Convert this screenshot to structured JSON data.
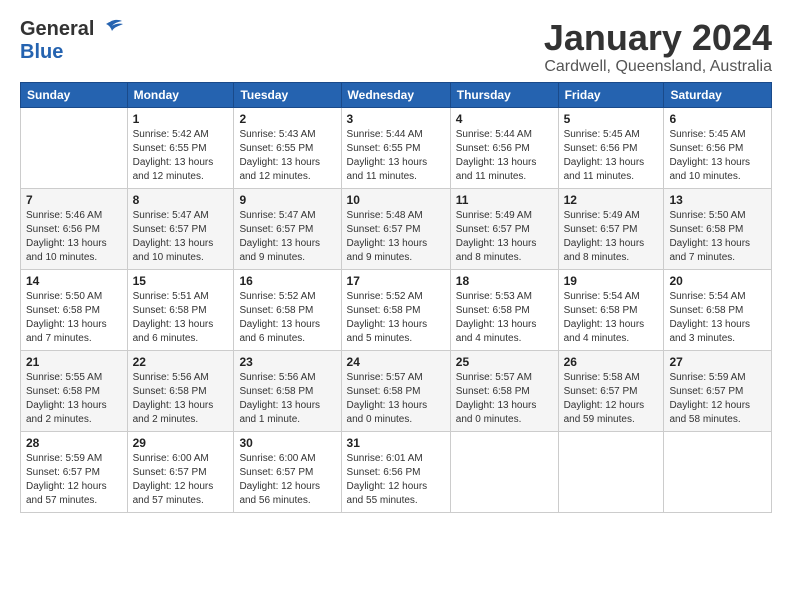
{
  "header": {
    "logo_general": "General",
    "logo_blue": "Blue",
    "month_title": "January 2024",
    "location": "Cardwell, Queensland, Australia"
  },
  "days_of_week": [
    "Sunday",
    "Monday",
    "Tuesday",
    "Wednesday",
    "Thursday",
    "Friday",
    "Saturday"
  ],
  "weeks": [
    [
      {
        "day": "",
        "info": ""
      },
      {
        "day": "1",
        "info": "Sunrise: 5:42 AM\nSunset: 6:55 PM\nDaylight: 13 hours\nand 12 minutes."
      },
      {
        "day": "2",
        "info": "Sunrise: 5:43 AM\nSunset: 6:55 PM\nDaylight: 13 hours\nand 12 minutes."
      },
      {
        "day": "3",
        "info": "Sunrise: 5:44 AM\nSunset: 6:55 PM\nDaylight: 13 hours\nand 11 minutes."
      },
      {
        "day": "4",
        "info": "Sunrise: 5:44 AM\nSunset: 6:56 PM\nDaylight: 13 hours\nand 11 minutes."
      },
      {
        "day": "5",
        "info": "Sunrise: 5:45 AM\nSunset: 6:56 PM\nDaylight: 13 hours\nand 11 minutes."
      },
      {
        "day": "6",
        "info": "Sunrise: 5:45 AM\nSunset: 6:56 PM\nDaylight: 13 hours\nand 10 minutes."
      }
    ],
    [
      {
        "day": "7",
        "info": "Sunrise: 5:46 AM\nSunset: 6:56 PM\nDaylight: 13 hours\nand 10 minutes."
      },
      {
        "day": "8",
        "info": "Sunrise: 5:47 AM\nSunset: 6:57 PM\nDaylight: 13 hours\nand 10 minutes."
      },
      {
        "day": "9",
        "info": "Sunrise: 5:47 AM\nSunset: 6:57 PM\nDaylight: 13 hours\nand 9 minutes."
      },
      {
        "day": "10",
        "info": "Sunrise: 5:48 AM\nSunset: 6:57 PM\nDaylight: 13 hours\nand 9 minutes."
      },
      {
        "day": "11",
        "info": "Sunrise: 5:49 AM\nSunset: 6:57 PM\nDaylight: 13 hours\nand 8 minutes."
      },
      {
        "day": "12",
        "info": "Sunrise: 5:49 AM\nSunset: 6:57 PM\nDaylight: 13 hours\nand 8 minutes."
      },
      {
        "day": "13",
        "info": "Sunrise: 5:50 AM\nSunset: 6:58 PM\nDaylight: 13 hours\nand 7 minutes."
      }
    ],
    [
      {
        "day": "14",
        "info": "Sunrise: 5:50 AM\nSunset: 6:58 PM\nDaylight: 13 hours\nand 7 minutes."
      },
      {
        "day": "15",
        "info": "Sunrise: 5:51 AM\nSunset: 6:58 PM\nDaylight: 13 hours\nand 6 minutes."
      },
      {
        "day": "16",
        "info": "Sunrise: 5:52 AM\nSunset: 6:58 PM\nDaylight: 13 hours\nand 6 minutes."
      },
      {
        "day": "17",
        "info": "Sunrise: 5:52 AM\nSunset: 6:58 PM\nDaylight: 13 hours\nand 5 minutes."
      },
      {
        "day": "18",
        "info": "Sunrise: 5:53 AM\nSunset: 6:58 PM\nDaylight: 13 hours\nand 4 minutes."
      },
      {
        "day": "19",
        "info": "Sunrise: 5:54 AM\nSunset: 6:58 PM\nDaylight: 13 hours\nand 4 minutes."
      },
      {
        "day": "20",
        "info": "Sunrise: 5:54 AM\nSunset: 6:58 PM\nDaylight: 13 hours\nand 3 minutes."
      }
    ],
    [
      {
        "day": "21",
        "info": "Sunrise: 5:55 AM\nSunset: 6:58 PM\nDaylight: 13 hours\nand 2 minutes."
      },
      {
        "day": "22",
        "info": "Sunrise: 5:56 AM\nSunset: 6:58 PM\nDaylight: 13 hours\nand 2 minutes."
      },
      {
        "day": "23",
        "info": "Sunrise: 5:56 AM\nSunset: 6:58 PM\nDaylight: 13 hours\nand 1 minute."
      },
      {
        "day": "24",
        "info": "Sunrise: 5:57 AM\nSunset: 6:58 PM\nDaylight: 13 hours\nand 0 minutes."
      },
      {
        "day": "25",
        "info": "Sunrise: 5:57 AM\nSunset: 6:58 PM\nDaylight: 13 hours\nand 0 minutes."
      },
      {
        "day": "26",
        "info": "Sunrise: 5:58 AM\nSunset: 6:57 PM\nDaylight: 12 hours\nand 59 minutes."
      },
      {
        "day": "27",
        "info": "Sunrise: 5:59 AM\nSunset: 6:57 PM\nDaylight: 12 hours\nand 58 minutes."
      }
    ],
    [
      {
        "day": "28",
        "info": "Sunrise: 5:59 AM\nSunset: 6:57 PM\nDaylight: 12 hours\nand 57 minutes."
      },
      {
        "day": "29",
        "info": "Sunrise: 6:00 AM\nSunset: 6:57 PM\nDaylight: 12 hours\nand 57 minutes."
      },
      {
        "day": "30",
        "info": "Sunrise: 6:00 AM\nSunset: 6:57 PM\nDaylight: 12 hours\nand 56 minutes."
      },
      {
        "day": "31",
        "info": "Sunrise: 6:01 AM\nSunset: 6:56 PM\nDaylight: 12 hours\nand 55 minutes."
      },
      {
        "day": "",
        "info": ""
      },
      {
        "day": "",
        "info": ""
      },
      {
        "day": "",
        "info": ""
      }
    ]
  ]
}
